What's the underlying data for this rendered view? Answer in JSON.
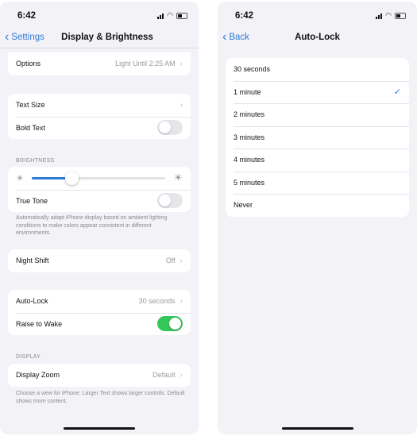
{
  "status": {
    "time": "6:42"
  },
  "left": {
    "nav": {
      "back": "Settings",
      "title": "Display & Brightness"
    },
    "options": {
      "label": "Options",
      "value": "Light Until 2:25 AM"
    },
    "text_size": "Text Size",
    "bold_text": {
      "label": "Bold Text",
      "on": false
    },
    "brightness_header": "BRIGHTNESS",
    "brightness_level": 0.3,
    "true_tone": {
      "label": "True Tone",
      "on": false
    },
    "true_tone_note": "Automatically adapt iPhone display based on ambient lighting conditions to make colors appear consistent in different environments.",
    "night_shift": {
      "label": "Night Shift",
      "value": "Off"
    },
    "auto_lock": {
      "label": "Auto-Lock",
      "value": "30 seconds"
    },
    "raise_to_wake": {
      "label": "Raise to Wake",
      "on": true
    },
    "display_header": "DISPLAY",
    "display_zoom": {
      "label": "Display Zoom",
      "value": "Default"
    },
    "display_zoom_note": "Choose a view for iPhone. Larger Text shows larger controls. Default shows more content."
  },
  "right": {
    "nav": {
      "back": "Back",
      "title": "Auto-Lock"
    },
    "options": [
      "30 seconds",
      "1 minute",
      "2 minutes",
      "3 minutes",
      "4 minutes",
      "5 minutes",
      "Never"
    ],
    "selected": "1 minute"
  },
  "colors": {
    "accent": "#2f7bd8",
    "toggle_on": "#34c759",
    "background": "#f2f2f7"
  }
}
